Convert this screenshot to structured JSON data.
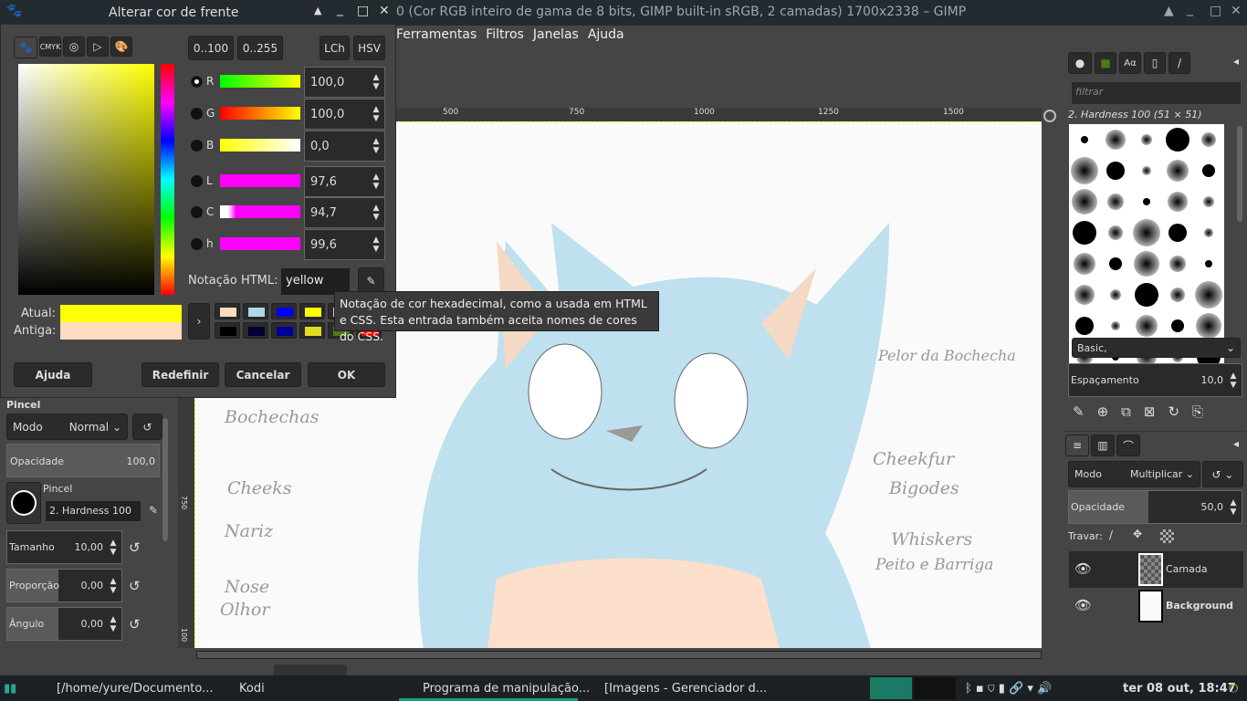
{
  "main_window": {
    "title": "0 (Cor RGB inteiro de gama de 8 bits, GIMP built-in sRGB, 2 camadas) 1700x2338 – GIMP",
    "menu": [
      "Ferramentas",
      "Filtros",
      "Janelas",
      "Ajuda"
    ],
    "ruler_ticks": [
      "500",
      "750",
      "1000",
      "1250",
      "1500"
    ],
    "vruler_ticks": [
      "750",
      "100"
    ]
  },
  "dialog": {
    "title": "Alterar cor de frente",
    "range_buttons": [
      "0..100",
      "0..255"
    ],
    "model_buttons": [
      "LCh",
      "HSV"
    ],
    "channels": [
      {
        "label": "R",
        "value": "100,0",
        "selected": true
      },
      {
        "label": "G",
        "value": "100,0"
      },
      {
        "label": "B",
        "value": "0,0"
      },
      {
        "label": "L",
        "value": "97,6"
      },
      {
        "label": "C",
        "value": "94,7"
      },
      {
        "label": "h",
        "value": "99,6"
      }
    ],
    "html_label": "Notação HTML:",
    "html_value": "yellow",
    "current_label": "Atual:",
    "old_label": "Antiga:",
    "current_color": "#ffff00",
    "old_color": "#ffdcc0",
    "history_colors": [
      "#ffdcbe",
      "#add8e6",
      "#0000ff",
      "#ffff00",
      "#ffc0cb",
      "#444444",
      "#000000",
      "#000033",
      "#000099",
      "#e0dc20",
      "#4a7a1a",
      "#ff0000"
    ],
    "buttons": {
      "help": "Ajuda",
      "reset": "Redefinir",
      "cancel": "Cancelar",
      "ok": "OK"
    },
    "tooltip": "Notação de cor hexadecimal, como a usada em HTML e CSS. Esta entrada também aceita nomes de cores do CSS."
  },
  "tool_options": {
    "title": "Pincel",
    "mode_label": "Modo",
    "mode_value": "Normal",
    "opacity_label": "Opacidade",
    "opacity_value": "100,0",
    "brush_label": "Pincel",
    "brush_name": "2. Hardness 100",
    "sliders": [
      {
        "label": "Tamanho",
        "value": "10,00"
      },
      {
        "label": "Proporção",
        "value": "0,00"
      },
      {
        "label": "Ângulo",
        "value": "0,00"
      }
    ]
  },
  "brushes": {
    "filter_placeholder": "filtrar",
    "current": "2. Hardness 100 (51 × 51)",
    "tag": "Basic,",
    "spacing_label": "Espaçamento",
    "spacing_value": "10,0"
  },
  "layers": {
    "mode_label": "Modo",
    "mode_value": "Multiplicar",
    "opacity_label": "Opacidade",
    "opacity_value": "50,0",
    "lock_label": "Travar:",
    "items": [
      {
        "name": "Camada"
      },
      {
        "name": "Background"
      }
    ]
  },
  "canvas_notes": [
    "Bochechas",
    "Cheeks",
    "Nariz",
    "Nose",
    "Olhor",
    "Pelor da Bochecha",
    "Cheekfur",
    "Bigodes",
    "Whiskers",
    "Peito e Barriga"
  ],
  "taskbar": {
    "items": [
      "[/home/yure/Documento...",
      "Kodi",
      "Programa de manipulação...",
      "[Imagens - Gerenciador d..."
    ],
    "clock": "ter 08 out, 18:47"
  }
}
